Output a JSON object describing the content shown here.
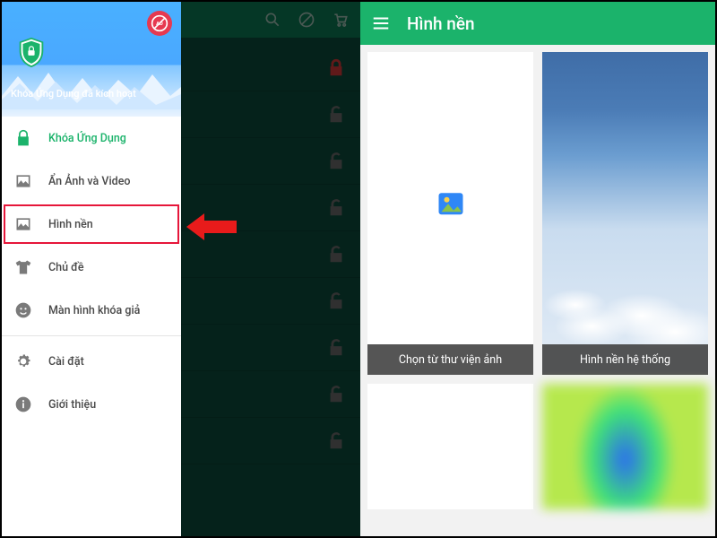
{
  "drawer": {
    "header_title": "Khóa Ứng Dụng đã kích hoạt",
    "items": [
      {
        "label": "Khóa Ứng Dụng",
        "icon": "lock"
      },
      {
        "label": "Ẩn Ảnh và Video",
        "icon": "image"
      },
      {
        "label": "Hình nền",
        "icon": "image"
      },
      {
        "label": "Chủ đề",
        "icon": "shirt"
      },
      {
        "label": "Màn hình khóa giả",
        "icon": "smiley"
      },
      {
        "label": "Cài đặt",
        "icon": "gear"
      },
      {
        "label": "Giới thiệu",
        "icon": "info"
      }
    ]
  },
  "wallpaper_screen": {
    "title": "Hình nền",
    "card1_caption": "Chọn từ thư viện ảnh",
    "card2_caption": "Hình nền hệ thống"
  }
}
